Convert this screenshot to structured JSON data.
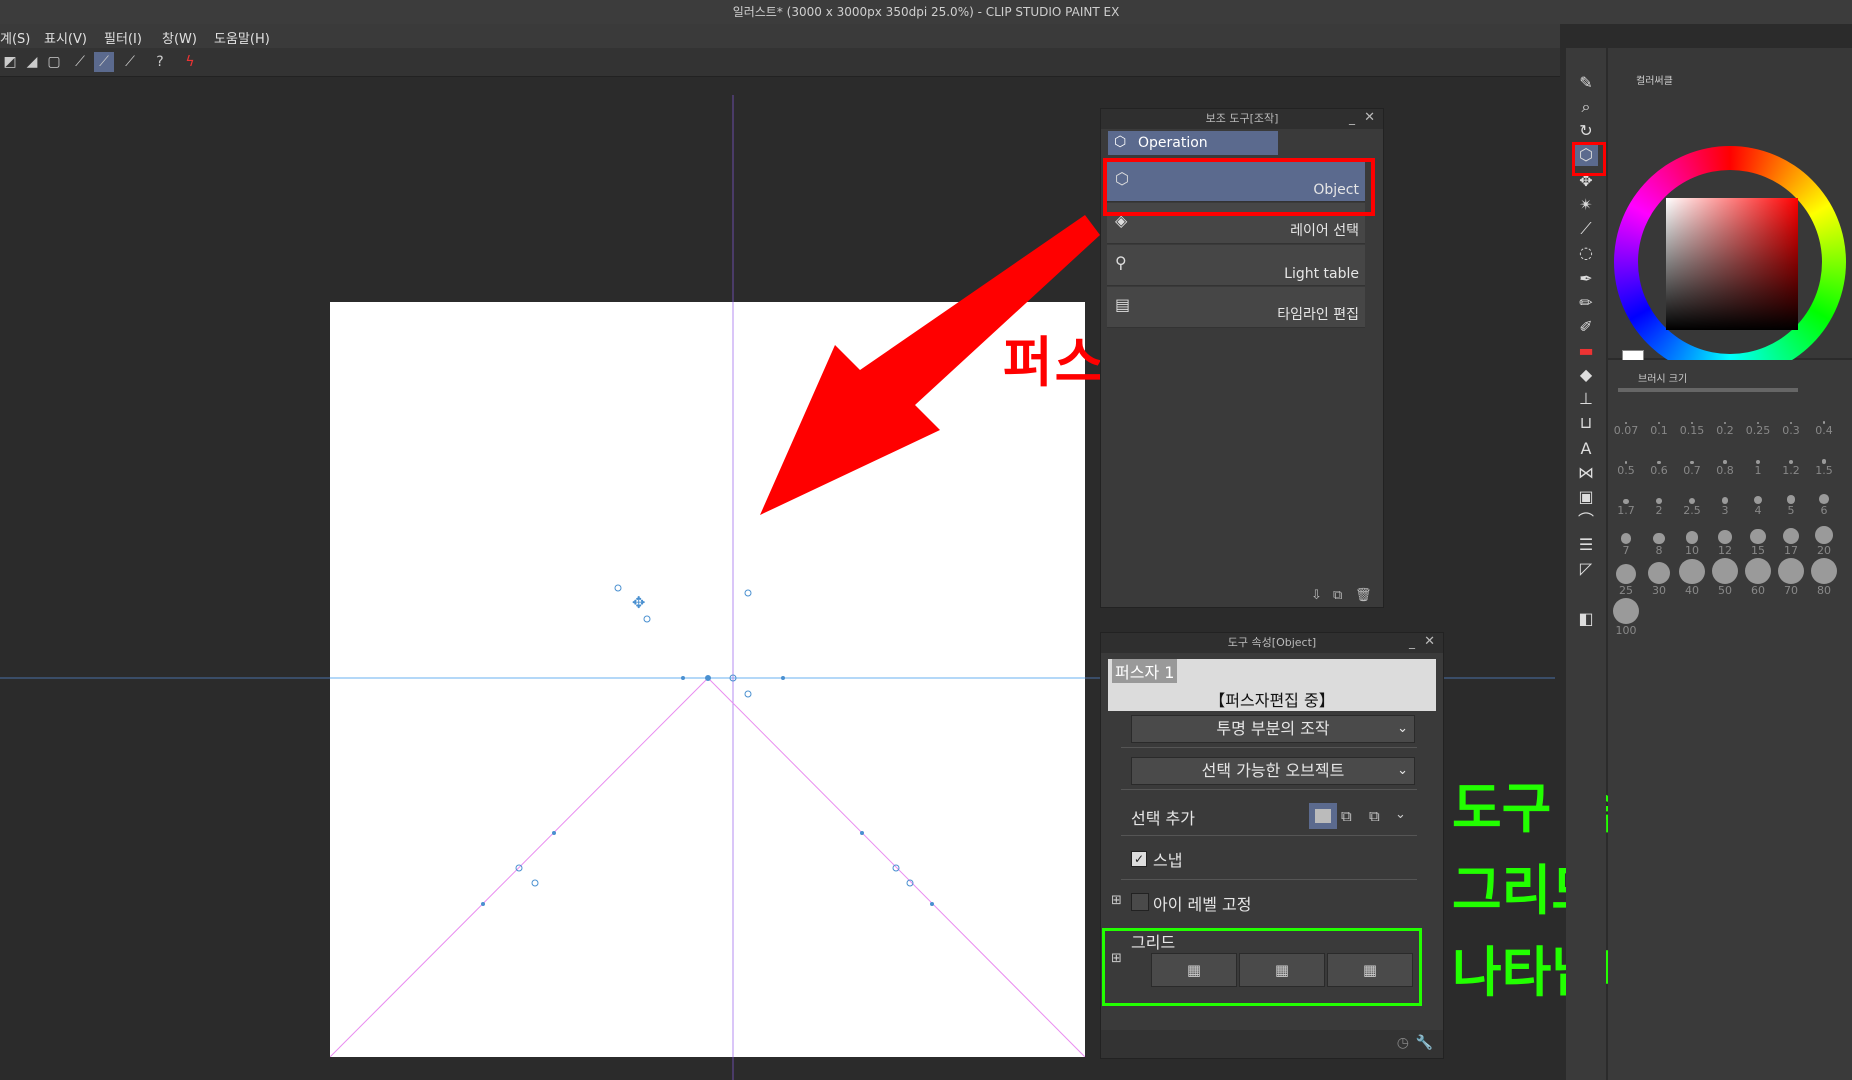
{
  "window": {
    "title": "일러스트* (3000 x 3000px 350dpi 25.0%)  - CLIP STUDIO PAINT EX"
  },
  "menu": [
    "계(S)",
    "표시(V)",
    "필터(I)",
    "창(W)",
    "도움말(H)"
  ],
  "sub_tool_panel": {
    "title": "보조 도구[조작]",
    "tab": "Operation",
    "items": [
      {
        "label": "Object",
        "icon": "object-select-icon"
      },
      {
        "label": "레이어 선택",
        "icon": "layer-select-icon"
      },
      {
        "label": "Light table",
        "icon": "light-table-icon"
      },
      {
        "label": "타임라인 편집",
        "icon": "timeline-icon"
      }
    ]
  },
  "tool_property_panel": {
    "title": "도구 속성[Object]",
    "preview_name": "퍼스자 1",
    "preview_caption": "【퍼스자편집 중】",
    "transparent_op": "투명 부분의 조작",
    "selectable_obj": "선택 가능한 오브젝트",
    "add_selection": "선택 추가",
    "snap": "스냅",
    "eye_level_fix": "아이 레벨 고정",
    "grid": "그리드"
  },
  "annotations": {
    "red_text": "퍼스 선 클릭",
    "green_lines": [
      "도구 속성 창에",
      "그리드 아이콘이",
      "나타납니다."
    ]
  },
  "color_panel": {
    "tab": "컬러써클",
    "r": "255",
    "g": "255",
    "b": "255"
  },
  "brush_panel": {
    "title": "브러시 크기",
    "sizes": [
      "0.07",
      "0.1",
      "0.15",
      "0.2",
      "0.25",
      "0.3",
      "0.4",
      "0.5",
      "0.6",
      "0.7",
      "0.8",
      "1",
      "1.2",
      "1.5",
      "1.7",
      "2",
      "2.5",
      "3",
      "4",
      "5",
      "6",
      "7",
      "8",
      "10",
      "12",
      "15",
      "17",
      "20",
      "25",
      "30",
      "40",
      "50",
      "60",
      "70",
      "80",
      "100"
    ]
  },
  "colors": {
    "red": "#ff0000",
    "green": "#22ff00",
    "accent": "#5b6a8e"
  }
}
